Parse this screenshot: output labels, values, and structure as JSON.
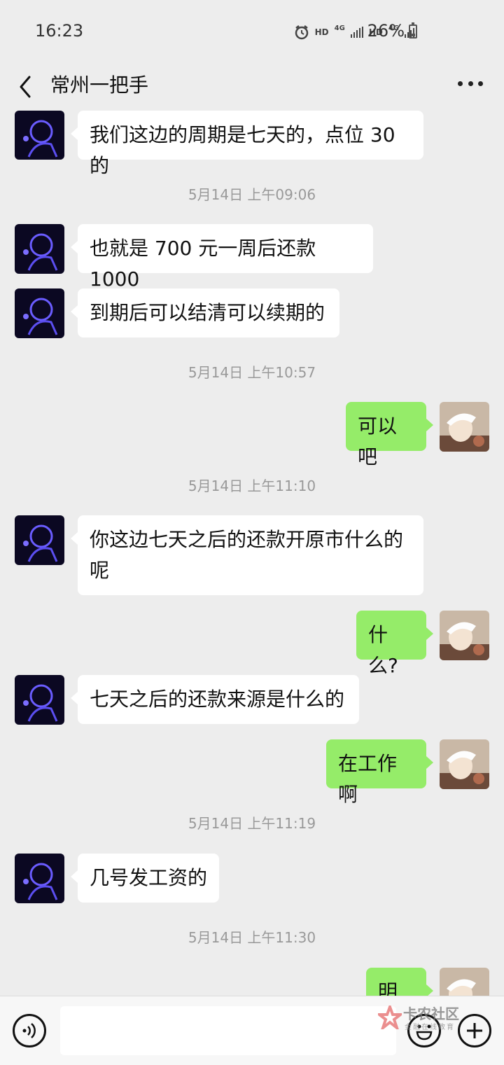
{
  "status_bar": {
    "time": "16:23",
    "hd1": "HD",
    "net1": "4G",
    "hd2": "HD",
    "net2": "4G",
    "battery": "26%"
  },
  "header": {
    "back_icon": "chevron-left-icon",
    "title": "常州一把手",
    "more_icon": "more-dots-icon"
  },
  "messages": [
    {
      "type": "text",
      "side": "in",
      "text": "我们这边的周期是七天的，点位 30 的"
    },
    {
      "type": "time",
      "text": "5月14日 上午09:06"
    },
    {
      "type": "text",
      "side": "in",
      "text": "也就是 700 元一周后还款 1000"
    },
    {
      "type": "text",
      "side": "in",
      "text": "到期后可以结清可以续期的"
    },
    {
      "type": "time",
      "text": "5月14日 上午10:57"
    },
    {
      "type": "text",
      "side": "out",
      "text": "可以吧"
    },
    {
      "type": "time",
      "text": "5月14日 上午11:10"
    },
    {
      "type": "text",
      "side": "in",
      "text": "你这边七天之后的还款开原市什么的呢"
    },
    {
      "type": "text",
      "side": "out",
      "text": "什么?"
    },
    {
      "type": "text",
      "side": "in",
      "text": "七天之后的还款来源是什么的"
    },
    {
      "type": "text",
      "side": "out",
      "text": "在工作啊"
    },
    {
      "type": "time",
      "text": "5月14日 上午11:19"
    },
    {
      "type": "text",
      "side": "in",
      "text": "几号发工资的"
    },
    {
      "type": "time",
      "text": "5月14日 上午11:30"
    },
    {
      "type": "text",
      "side": "out",
      "text": "明天"
    }
  ],
  "input_bar": {
    "voice_icon": "voice-icon",
    "input_value": "",
    "emoji_icon": "emoji-icon",
    "plus_icon": "plus-icon"
  },
  "watermark": {
    "text": "卡农社区",
    "subtext": "金融在线教育"
  },
  "colors": {
    "background": "#ededed",
    "incoming_bubble": "#ffffff",
    "outgoing_bubble": "#95ec69"
  }
}
